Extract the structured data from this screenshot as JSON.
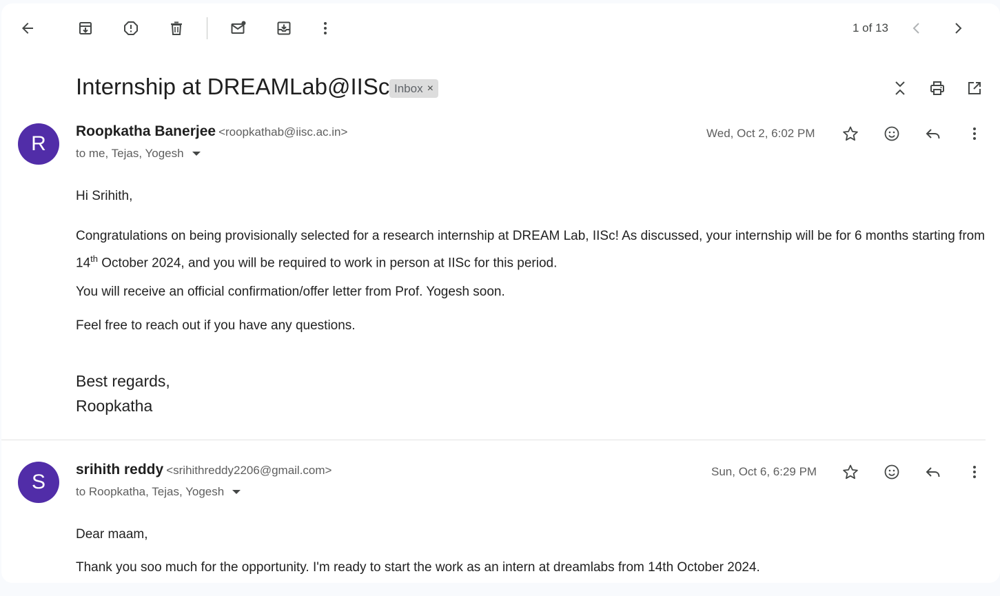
{
  "toolbar": {
    "pager_text": "1 of 13",
    "icons": [
      "back-arrow-icon",
      "archive-icon",
      "report-spam-icon",
      "delete-icon",
      "mark-unread-icon",
      "move-to-icon",
      "more-vert-icon",
      "chevron-left-icon",
      "chevron-right-icon"
    ]
  },
  "thread": {
    "subject": "Internship at DREAMLab@IISc",
    "label": "Inbox",
    "label_remove": "×"
  },
  "messages": [
    {
      "avatar_letter": "R",
      "sender_name": "Roopkatha Banerjee",
      "sender_email": "<roopkathab@iisc.ac.in>",
      "recipients": "to me, Tejas, Yogesh",
      "date": "Wed, Oct 2, 6:02 PM",
      "greeting": "Hi Srihith,",
      "para1_a": "Congratulations on being provisionally selected for a research internship at DREAM Lab, IISc! As discussed, your internship will be for 6 months starting from 14",
      "para1_sup": "th",
      "para1_b": " October 2024, and you will be required to work in person at IISc for this period.",
      "para2": "You will receive an official confirmation/offer letter from Prof. Yogesh soon.",
      "para3": "Feel free to reach out if you have any questions.",
      "signoff": "Best regards,",
      "signature": "Roopkatha"
    },
    {
      "avatar_letter": "S",
      "sender_name": "srihith reddy",
      "sender_email": "<srihithreddy2206@gmail.com>",
      "recipients": "to Roopkatha, Tejas, Yogesh",
      "date": "Sun, Oct 6, 6:29 PM",
      "greeting": "Dear maam,",
      "para1": "Thank you soo much for the opportunity. I'm ready to start the work as an intern at dreamlabs from 14th October 2024."
    }
  ],
  "colors": {
    "avatar_bg": "#512da8",
    "label_chip_bg": "#dddddd",
    "icon": "#444746"
  }
}
